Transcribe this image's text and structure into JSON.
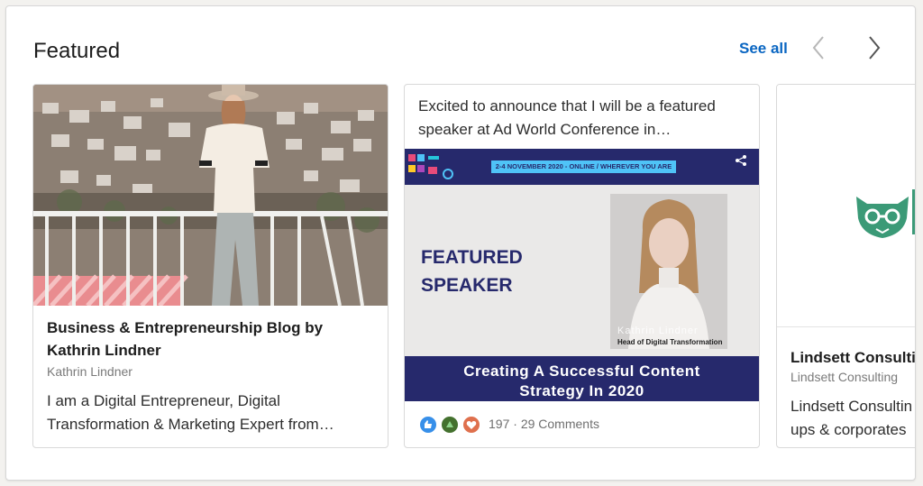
{
  "section": {
    "title": "Featured",
    "see_all": "See all"
  },
  "colors": {
    "accent": "#0a66c2",
    "banner_navy": "#26296c",
    "logo_green": "#3b9a77"
  },
  "cards": [
    {
      "title": "Business & Entrepreneurship Blog by Kathrin Lindner",
      "author": "Kathrin Lindner",
      "description": "I am a Digital Entrepreneur, Digital Transformation & Marketing Expert from…"
    },
    {
      "post_text": "Excited to announce that I will be a featured speaker at Ad World Conference in…",
      "banner": {
        "dates": "2-4 NOVEMBER 2020 - ONLINE / WHEREVER YOU ARE",
        "featured_line1": "FEATURED",
        "featured_line2": "SPEAKER",
        "speaker_name": "Kathrin Lindner",
        "speaker_role": "Head of Digital Transformation",
        "talk_line1": "Creating A Successful Content",
        "talk_line2": "Strategy In 2020"
      },
      "reaction_count": "197",
      "comments": "29 Comments",
      "reaction_icons": [
        "like-icon",
        "celebrate-icon",
        "love-icon"
      ]
    },
    {
      "title": "Lindsett Consulti",
      "author": "Lindsett Consulting",
      "description_line1": "Lindsett Consultin",
      "description_line2": "ups & corporates"
    }
  ]
}
